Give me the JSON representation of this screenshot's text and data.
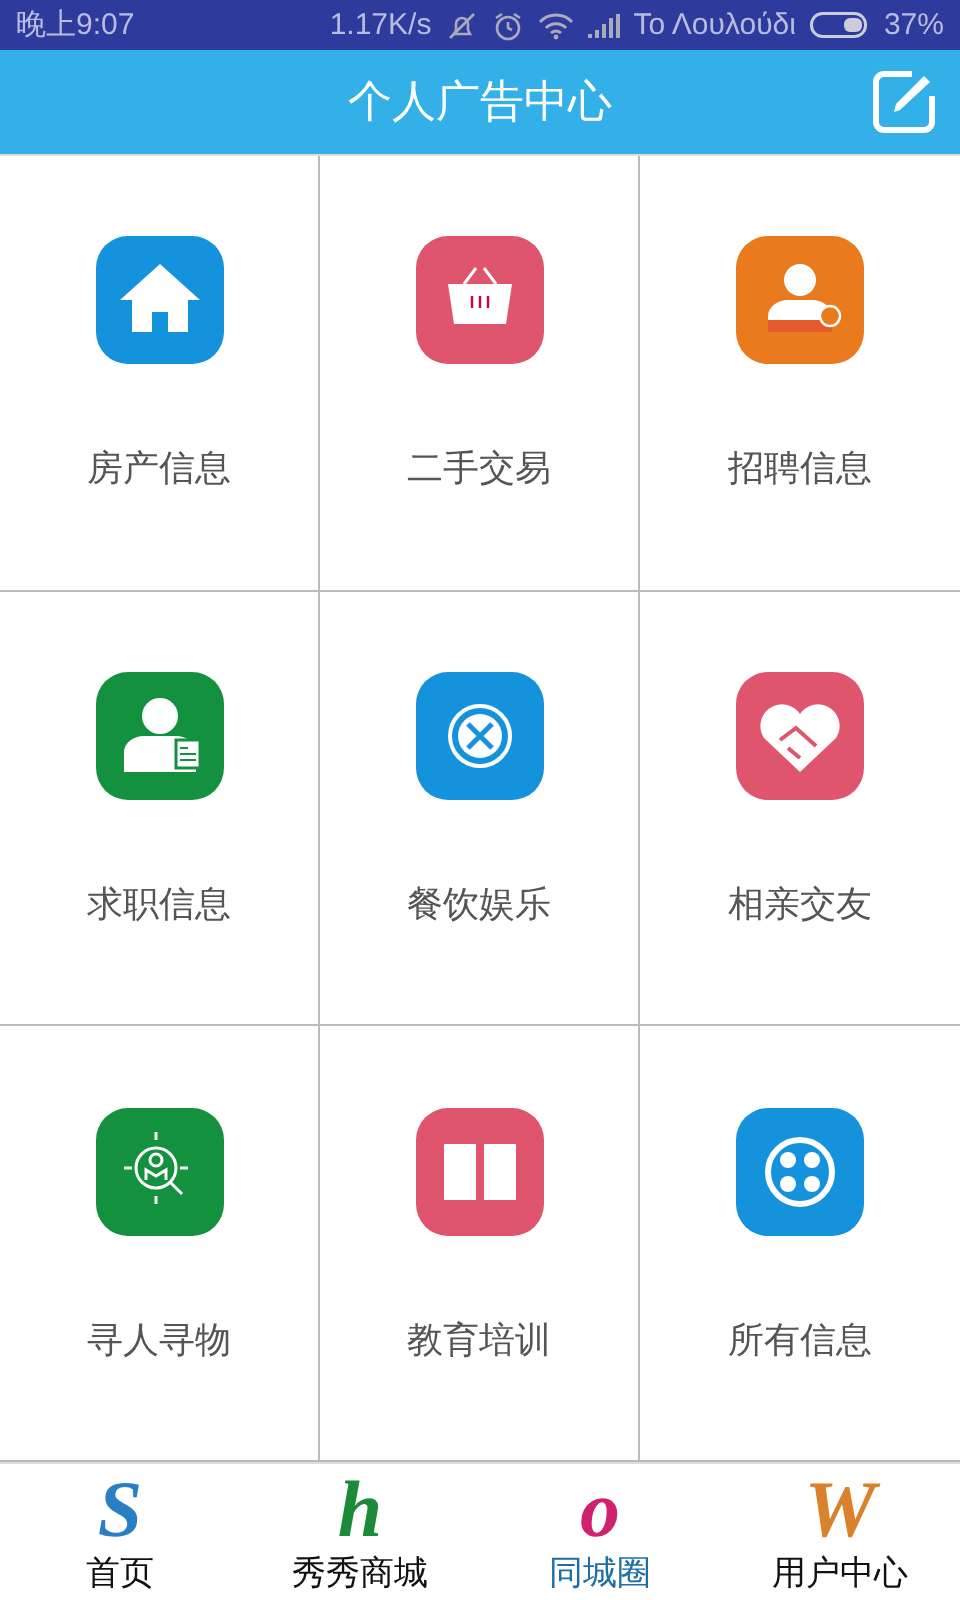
{
  "status_bar": {
    "time": "晚上9:07",
    "speed": "1.17K/s",
    "carrier": "Το Λουλούδι",
    "battery": "37%"
  },
  "header": {
    "title": "个人广告中心"
  },
  "tiles": [
    {
      "label": "房产信息",
      "kind": "house",
      "color": "#1492dc"
    },
    {
      "label": "二手交易",
      "kind": "basket",
      "color": "#e0556e"
    },
    {
      "label": "招聘信息",
      "kind": "recruit",
      "color": "#ea7a1e"
    },
    {
      "label": "求职信息",
      "kind": "jobseek",
      "color": "#13913f"
    },
    {
      "label": "餐饮娱乐",
      "kind": "dining",
      "color": "#1492dc"
    },
    {
      "label": "相亲交友",
      "kind": "handshake",
      "color": "#e0556e"
    },
    {
      "label": "寻人寻物",
      "kind": "search",
      "color": "#13913f"
    },
    {
      "label": "教育培训",
      "kind": "book",
      "color": "#e0556e"
    },
    {
      "label": "所有信息",
      "kind": "dots",
      "color": "#1492dc"
    }
  ],
  "tabs": [
    {
      "letter": "S",
      "label": "首页",
      "selected": false,
      "color": "#2a7fc4"
    },
    {
      "letter": "h",
      "label": "秀秀商城",
      "selected": false,
      "color": "#1d8a3a"
    },
    {
      "letter": "o",
      "label": "同城圈",
      "selected": true,
      "color": "#d0206e"
    },
    {
      "letter": "W",
      "label": "用户中心",
      "selected": false,
      "color": "#d9822b"
    }
  ]
}
